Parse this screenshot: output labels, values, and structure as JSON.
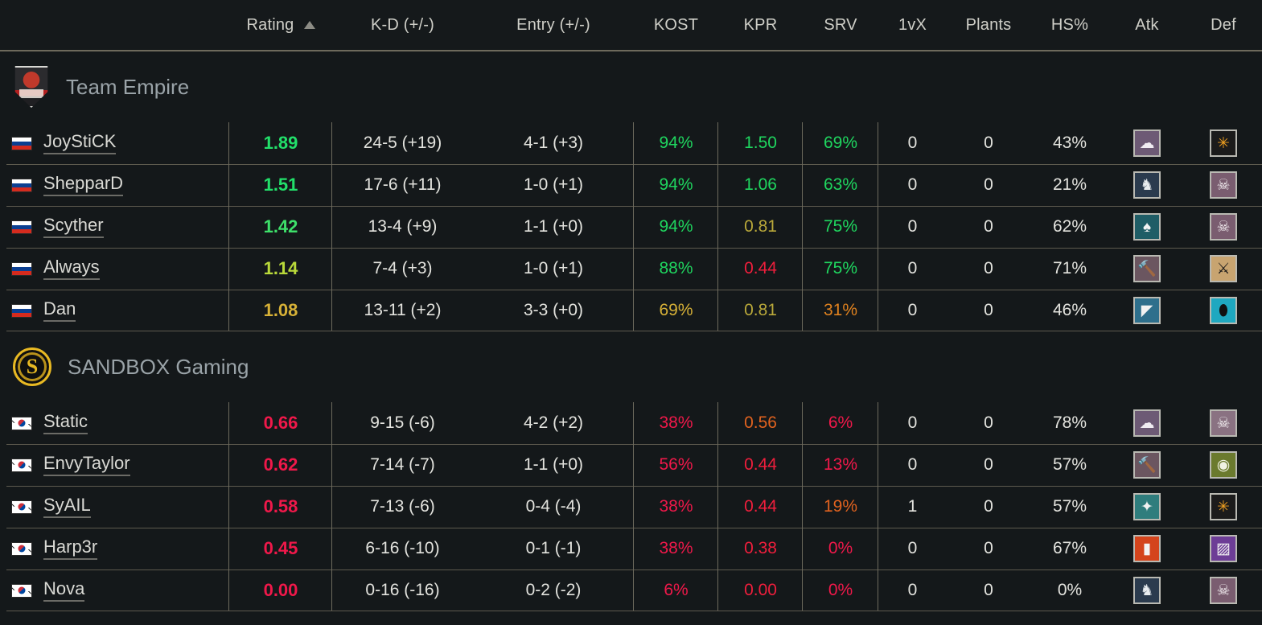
{
  "header": {
    "columns": [
      {
        "key": "player",
        "label": ""
      },
      {
        "key": "rating",
        "label": "Rating"
      },
      {
        "key": "kd",
        "label": "K-D (+/-)"
      },
      {
        "key": "entry",
        "label": "Entry (+/-)"
      },
      {
        "key": "kost",
        "label": "KOST"
      },
      {
        "key": "kpr",
        "label": "KPR"
      },
      {
        "key": "srv",
        "label": "SRV"
      },
      {
        "key": "onevx",
        "label": "1vX"
      },
      {
        "key": "plants",
        "label": "Plants"
      },
      {
        "key": "hs",
        "label": "HS%"
      },
      {
        "key": "atk",
        "label": "Atk"
      },
      {
        "key": "def",
        "label": "Def"
      }
    ],
    "sort_column": "Rating",
    "sort_direction": "ascending",
    "sort_icon": "triangle-up-icon"
  },
  "colors": {
    "background": "#14181a",
    "grid_line": "#6d6a5d",
    "text": "#e3e3de",
    "green_high": "#22e06a",
    "green": "#1fd65f",
    "yellow_green": "#b9d93a",
    "gold": "#d7b137",
    "orange": "#e0821f",
    "red": "#f0184a",
    "red_bright": "#ef1e3c"
  },
  "teams": [
    {
      "name": "Team Empire",
      "logo": "team-empire-logo",
      "logo_style": "empire",
      "players": [
        {
          "flag": "flag-russia",
          "flag_style": "ru",
          "name": "JoyStiCK",
          "rating": "1.89",
          "rating_color": "#22e06a",
          "kd": "24-5 (+19)",
          "entry": "4-1 (+3)",
          "kost": "94%",
          "kost_color": "#1fd65f",
          "kpr": "1.50",
          "kpr_color": "#1fd65f",
          "srv": "69%",
          "srv_color": "#1fd65f",
          "onevx": "0",
          "plants": "0",
          "hs": "43%",
          "atk_icon": "operator-smoke-icon",
          "atk_glyph": "☁",
          "atk_bg": "#6d5a75",
          "atk_fg": "#f0ecf2",
          "def_icon": "operator-mute-icon",
          "def_glyph": "✳",
          "def_bg": "#1b1b1b",
          "def_fg": "#f0a020"
        },
        {
          "flag": "flag-russia",
          "flag_style": "ru",
          "name": "ShepparD",
          "rating": "1.51",
          "rating_color": "#22e06a",
          "kd": "17-6 (+11)",
          "entry": "1-0 (+1)",
          "kost": "94%",
          "kost_color": "#1fd65f",
          "kpr": "1.06",
          "kpr_color": "#1fd65f",
          "srv": "63%",
          "srv_color": "#1fd65f",
          "onevx": "0",
          "plants": "0",
          "hs": "21%",
          "atk_icon": "operator-blackbeard-icon",
          "atk_glyph": "♞",
          "atk_bg": "#2b3b4e",
          "atk_fg": "#e8ecef",
          "def_icon": "operator-caveira-icon",
          "def_glyph": "☠",
          "def_bg": "#7a5d70",
          "def_fg": "#f4f0f2"
        },
        {
          "flag": "flag-russia",
          "flag_style": "ru",
          "name": "Scyther",
          "rating": "1.42",
          "rating_color": "#3ee06a",
          "kd": "13-4 (+9)",
          "entry": "1-1 (+0)",
          "kost": "94%",
          "kost_color": "#1fd65f",
          "kpr": "0.81",
          "kpr_color": "#b9a83a",
          "srv": "75%",
          "srv_color": "#1fd65f",
          "onevx": "0",
          "plants": "0",
          "hs": "62%",
          "atk_icon": "operator-ace-icon",
          "atk_glyph": "♠",
          "atk_bg": "#1f5d66",
          "atk_fg": "#f2f2f2",
          "def_icon": "operator-caveira-icon",
          "def_glyph": "☠",
          "def_bg": "#7a5d70",
          "def_fg": "#f4f0f2"
        },
        {
          "flag": "flag-russia",
          "flag_style": "ru",
          "name": "Always",
          "rating": "1.14",
          "rating_color": "#b9d93a",
          "kd": "7-4 (+3)",
          "entry": "1-0 (+1)",
          "kost": "88%",
          "kost_color": "#1fd65f",
          "kpr": "0.44",
          "kpr_color": "#ef1e3c",
          "srv": "75%",
          "srv_color": "#1fd65f",
          "onevx": "0",
          "plants": "0",
          "hs": "71%",
          "atk_icon": "operator-sledge-icon",
          "atk_glyph": "🔨",
          "atk_bg": "#6b5660",
          "atk_fg": "#f0eaee",
          "def_icon": "operator-kaid-icon",
          "def_glyph": "⚔",
          "def_bg": "#c8a470",
          "def_fg": "#171717"
        },
        {
          "flag": "flag-russia",
          "flag_style": "ru",
          "name": "Dan",
          "rating": "1.08",
          "rating_color": "#d7b137",
          "kd": "13-11 (+2)",
          "entry": "3-3 (+0)",
          "kost": "69%",
          "kost_color": "#d7b137",
          "kpr": "0.81",
          "kpr_color": "#b9a83a",
          "srv": "31%",
          "srv_color": "#e0821f",
          "onevx": "0",
          "plants": "0",
          "hs": "46%",
          "atk_icon": "operator-nokk-icon",
          "atk_glyph": "◤",
          "atk_bg": "#2e6f8c",
          "atk_fg": "#f2f2f2",
          "def_icon": "operator-clash-icon",
          "def_glyph": "⬮",
          "def_bg": "#1fa8c0",
          "def_fg": "#111111"
        }
      ]
    },
    {
      "name": "SANDBOX Gaming",
      "logo": "sandbox-gaming-logo",
      "logo_style": "sandbox",
      "players": [
        {
          "flag": "flag-south-korea",
          "flag_style": "kr",
          "name": "Static",
          "rating": "0.66",
          "rating_color": "#f0184a",
          "kd": "9-15 (-6)",
          "entry": "4-2 (+2)",
          "kost": "38%",
          "kost_color": "#f0184a",
          "kpr": "0.56",
          "kpr_color": "#e0621f",
          "srv": "6%",
          "srv_color": "#f0184a",
          "onevx": "0",
          "plants": "0",
          "hs": "78%",
          "atk_icon": "operator-smoke-icon",
          "atk_glyph": "☁",
          "atk_bg": "#6d5a75",
          "atk_fg": "#f0ecf2",
          "def_icon": "operator-vigil-icon",
          "def_glyph": "☠",
          "def_bg": "#8a7282",
          "def_fg": "#f2eff1"
        },
        {
          "flag": "flag-south-korea",
          "flag_style": "kr",
          "name": "EnvyTaylor",
          "rating": "0.62",
          "rating_color": "#f0184a",
          "kd": "7-14 (-7)",
          "entry": "1-1 (+0)",
          "kost": "56%",
          "kost_color": "#f0184a",
          "kpr": "0.44",
          "kpr_color": "#ef1e3c",
          "srv": "13%",
          "srv_color": "#f0184a",
          "onevx": "0",
          "plants": "0",
          "hs": "57%",
          "atk_icon": "operator-sledge-icon",
          "atk_glyph": "🔨",
          "atk_bg": "#6b5660",
          "atk_fg": "#f0eaee",
          "def_icon": "operator-ela-icon",
          "def_glyph": "◉",
          "def_bg": "#6b7a2e",
          "def_fg": "#f0f2e4"
        },
        {
          "flag": "flag-south-korea",
          "flag_style": "kr",
          "name": "SyAIL",
          "rating": "0.58",
          "rating_color": "#f0184a",
          "kd": "7-13 (-6)",
          "entry": "0-4 (-4)",
          "kost": "38%",
          "kost_color": "#f0184a",
          "kpr": "0.44",
          "kpr_color": "#ef1e3c",
          "srv": "19%",
          "srv_color": "#e0621f",
          "onevx": "1",
          "plants": "0",
          "hs": "57%",
          "atk_icon": "operator-hibana-icon",
          "atk_glyph": "✦",
          "atk_bg": "#2f7d7d",
          "atk_fg": "#f2f2f2",
          "def_icon": "operator-mute-icon",
          "def_glyph": "✳",
          "def_bg": "#1b1b1b",
          "def_fg": "#f0a020"
        },
        {
          "flag": "flag-south-korea",
          "flag_style": "kr",
          "name": "Harp3r",
          "rating": "0.45",
          "rating_color": "#f0184a",
          "kd": "6-16 (-10)",
          "entry": "0-1 (-1)",
          "kost": "38%",
          "kost_color": "#f0184a",
          "kpr": "0.38",
          "kpr_color": "#ef1e3c",
          "srv": "0%",
          "srv_color": "#f0184a",
          "onevx": "0",
          "plants": "0",
          "hs": "67%",
          "atk_icon": "operator-thermite-icon",
          "atk_glyph": "▮",
          "atk_bg": "#d4441c",
          "atk_fg": "#f2f2f2",
          "def_icon": "operator-mira-icon",
          "def_glyph": "▨",
          "def_bg": "#6d3d96",
          "def_fg": "#f2f2f2"
        },
        {
          "flag": "flag-south-korea",
          "flag_style": "kr",
          "name": "Nova",
          "rating": "0.00",
          "rating_color": "#f0184a",
          "kd": "0-16 (-16)",
          "entry": "0-2 (-2)",
          "kost": "6%",
          "kost_color": "#f0184a",
          "kpr": "0.00",
          "kpr_color": "#ef1e3c",
          "srv": "0%",
          "srv_color": "#f0184a",
          "onevx": "0",
          "plants": "0",
          "hs": "0%",
          "atk_icon": "operator-blackbeard-icon",
          "atk_glyph": "♞",
          "atk_bg": "#2b3b4e",
          "atk_fg": "#e8ecef",
          "def_icon": "operator-caveira-icon",
          "def_glyph": "☠",
          "def_bg": "#7a5d70",
          "def_fg": "#f4f0f2"
        }
      ]
    }
  ]
}
